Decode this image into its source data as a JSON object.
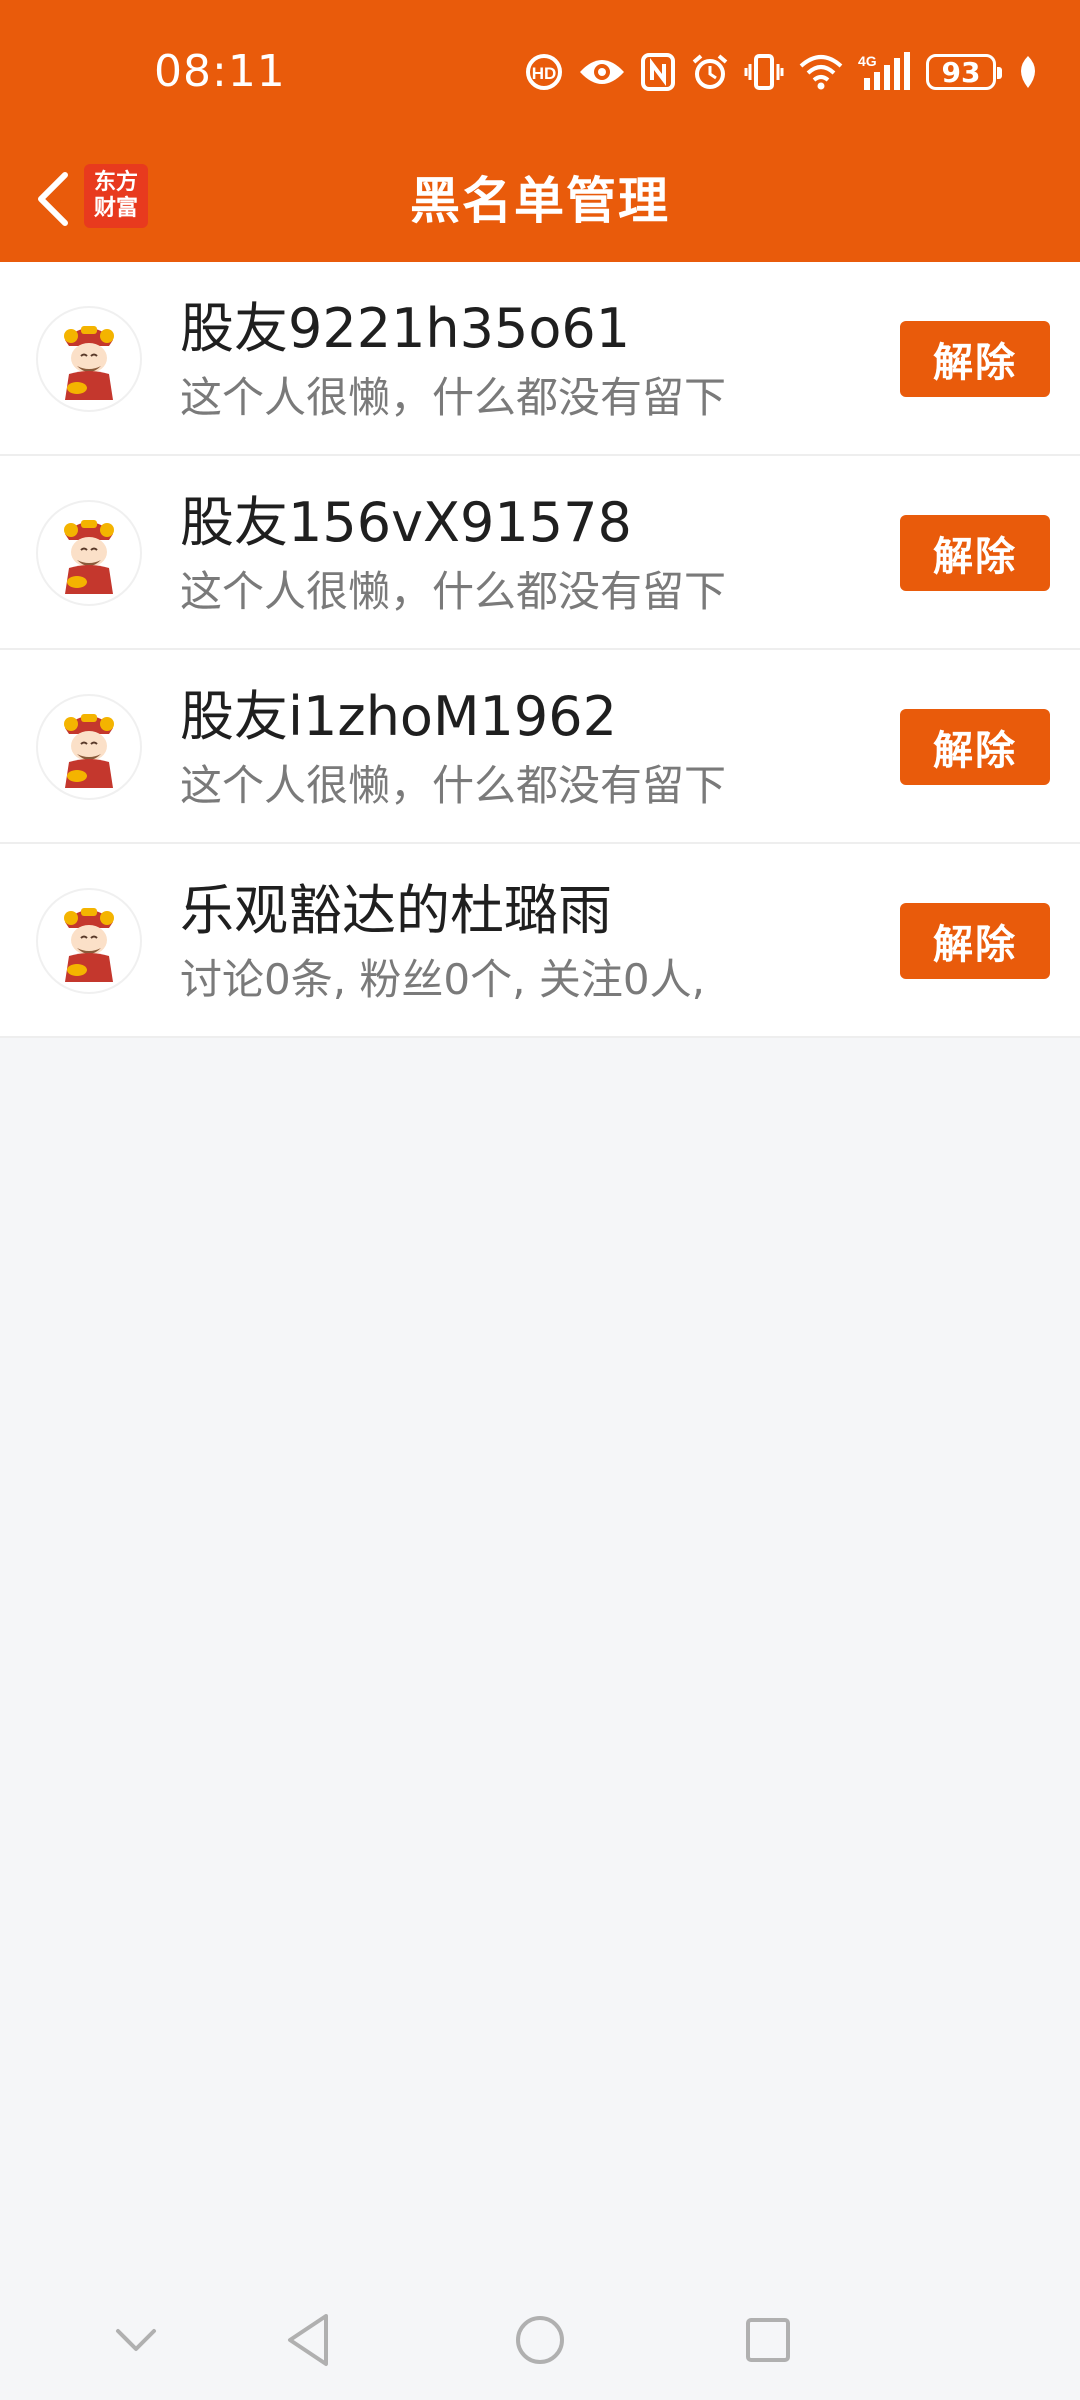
{
  "status_bar": {
    "time": "08:11",
    "battery": "93",
    "icons": [
      "hd-call-icon",
      "eye-icon",
      "nfc-icon",
      "alarm-icon",
      "vibrate-icon",
      "wifi-icon",
      "signal-4g-icon",
      "battery-icon",
      "leaf-icon"
    ]
  },
  "app_bar": {
    "title": "黑名单管理",
    "logo_line1": "东方",
    "logo_line2": "财富",
    "back_icon": "chevron-left-icon"
  },
  "blacklist": [
    {
      "name": "股友9221h35o61",
      "desc": "这个人很懒，什么都没有留下",
      "button": "解除"
    },
    {
      "name": "股友156vX91578",
      "desc": "这个人很懒，什么都没有留下",
      "button": "解除"
    },
    {
      "name": "股友i1zhoM1962",
      "desc": "这个人很懒，什么都没有留下",
      "button": "解除"
    },
    {
      "name": "乐观豁达的杜璐雨",
      "desc": "讨论0条, 粉丝0个, 关注0人,",
      "button": "解除"
    }
  ],
  "nav_bar": {
    "icons": [
      "chevron-down-icon",
      "back-triangle-icon",
      "home-circle-icon",
      "recents-square-icon"
    ]
  },
  "colors": {
    "accent": "#e95b0b",
    "background": "#f5f6f8",
    "text_primary": "#1f1f1f",
    "text_secondary": "#7a7a7a"
  }
}
